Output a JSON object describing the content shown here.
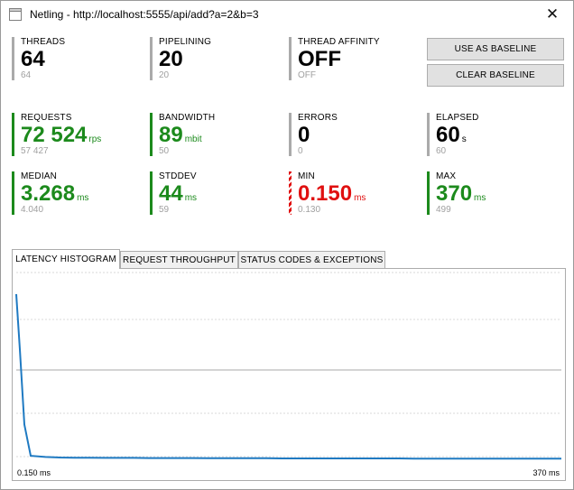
{
  "window": {
    "title": "Netling - http://localhost:5555/api/add?a=2&b=3",
    "close_glyph": "✕",
    "icon": "app-icon"
  },
  "metrics": {
    "threads": {
      "label": "THREADS",
      "value": "64",
      "unit": "",
      "baseline": "64",
      "status": "neutral"
    },
    "pipelining": {
      "label": "PIPELINING",
      "value": "20",
      "unit": "",
      "baseline": "20",
      "status": "neutral"
    },
    "affinity": {
      "label": "THREAD AFFINITY",
      "value": "OFF",
      "unit": "",
      "baseline": "OFF",
      "status": "neutral"
    },
    "requests": {
      "label": "REQUESTS",
      "value": "72 524",
      "unit": "rps",
      "baseline": "57 427",
      "status": "better"
    },
    "bandwidth": {
      "label": "BANDWIDTH",
      "value": "89",
      "unit": "mbit",
      "baseline": "50",
      "status": "better"
    },
    "errors": {
      "label": "ERRORS",
      "value": "0",
      "unit": "",
      "baseline": "0",
      "status": "neutral"
    },
    "elapsed": {
      "label": "ELAPSED",
      "value": "60",
      "unit": "s",
      "baseline": "60",
      "status": "neutral"
    },
    "median": {
      "label": "MEDIAN",
      "value": "3.268",
      "unit": "ms",
      "baseline": "4.040",
      "status": "better"
    },
    "stddev": {
      "label": "STDDEV",
      "value": "44",
      "unit": "ms",
      "baseline": "59",
      "status": "better"
    },
    "min": {
      "label": "MIN",
      "value": "0.150",
      "unit": "ms",
      "baseline": "0.130",
      "status": "worse"
    },
    "max": {
      "label": "MAX",
      "value": "370",
      "unit": "ms",
      "baseline": "499",
      "status": "better"
    }
  },
  "buttons": {
    "use_baseline": "USE AS BASELINE",
    "clear_baseline": "CLEAR BASELINE"
  },
  "tabs": [
    {
      "label": "LATENCY HISTOGRAM",
      "active": true
    },
    {
      "label": "REQUEST THROUGHPUT",
      "active": false
    },
    {
      "label": "STATUS CODES & EXCEPTIONS",
      "active": false
    }
  ],
  "colors": {
    "better": "#1c8a1c",
    "worse": "#e01010",
    "neutral_bar": "#aaaaaa",
    "series": "#1f7ac2",
    "grid": "#d9d9d9"
  },
  "chart_data": {
    "type": "line",
    "title": "",
    "xlabel": "",
    "ylabel": "",
    "x_min_label": "0.150 ms",
    "x_max_label": "370 ms",
    "xlim": [
      0.15,
      370
    ],
    "ylim": [
      0,
      1
    ],
    "grid": true,
    "series": [
      {
        "values": [
          0.93,
          0.62,
          0.2,
          0.025,
          0.018,
          0.015,
          0.014,
          0.014,
          0.013,
          0.013,
          0.013,
          0.012,
          0.012,
          0.012,
          0.012,
          0.011,
          0.011,
          0.011,
          0.011,
          0.011,
          0.01,
          0.01,
          0.01,
          0.01,
          0.01,
          0.01,
          0.01,
          0.01,
          0.01,
          0.009,
          0.009,
          0.009,
          0.009,
          0.009,
          0.009,
          0.009,
          0.009,
          0.009,
          0.009,
          0.009
        ]
      }
    ]
  }
}
